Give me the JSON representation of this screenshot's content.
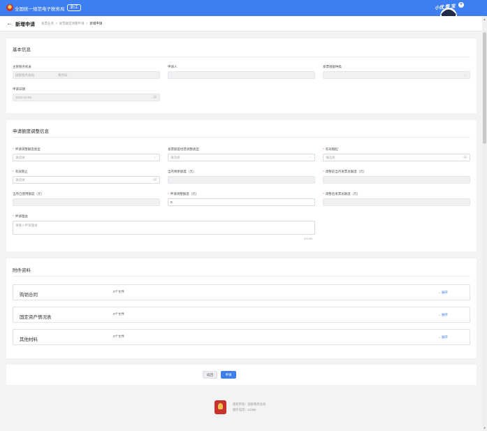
{
  "header": {
    "site_title": "全国统一规范电子税务局",
    "site_badge": "浙江",
    "mascot_label": "小优 帮 宝",
    "plus": "+"
  },
  "page": {
    "back_icon": "←",
    "title": "新增申请",
    "breadcrumbs": [
      "发票业务",
      "发票额度调整申请",
      "新增申请"
    ],
    "breadcrumb_sep": ">"
  },
  "basic_info": {
    "section_title": "基本信息",
    "tax_authority": {
      "label": "主管税务机关",
      "value": "国家税务总局",
      "value2": "税务局"
    },
    "applicant": {
      "label": "申请人",
      "value": ""
    },
    "invoice_type": {
      "label": "发票限额种类",
      "placeholder": ""
    },
    "apply_date": {
      "label": "申请日期",
      "value": "2025-01-06"
    }
  },
  "quota_info": {
    "section_title": "申请额度调整信息",
    "adjust_type": {
      "label": "申请调整额度类型",
      "placeholder": "请选择",
      "required": true
    },
    "process_type": {
      "label": "发票额度经营调整类型",
      "placeholder": "请选择"
    },
    "valid_start": {
      "label": "有效期起",
      "placeholder": "请选择",
      "required": true
    },
    "valid_end": {
      "label": "有效期止",
      "placeholder": "请选择",
      "required": true
    },
    "month_remaining": {
      "label": "当月剩余额度（元）",
      "value": ""
    },
    "before_adjust_total": {
      "label": "调整前当月发票总额度（元）",
      "value": "",
      "required": true
    },
    "month_used": {
      "label": "当月已使用额度（元）",
      "value": ""
    },
    "apply_adjust": {
      "label": "申请调整额度（元）",
      "value": "0",
      "required": true
    },
    "after_adjust_total": {
      "label": "调整后发票总额度（元）",
      "value": "",
      "required": true
    },
    "reason": {
      "label": "申请理由",
      "placeholder": "请输入申请理由",
      "counter": "0/1000",
      "required": true
    }
  },
  "attachments": {
    "section_title": "附件资料",
    "items": [
      {
        "name": "购销合同",
        "count": "0个文件",
        "action": "展开"
      },
      {
        "name": "固定资产情况表",
        "count": "0个文件",
        "action": "展开"
      },
      {
        "name": "其他材料",
        "count": "0个文件",
        "action": "展开"
      }
    ]
  },
  "actions": {
    "back_label": "返回",
    "submit_label": "申请"
  },
  "footer": {
    "line1": "版权所有：国家税务总局",
    "line2": "服务电话：12366"
  },
  "colors": {
    "brand": "#3d7ef1",
    "required": "#f05b55"
  }
}
